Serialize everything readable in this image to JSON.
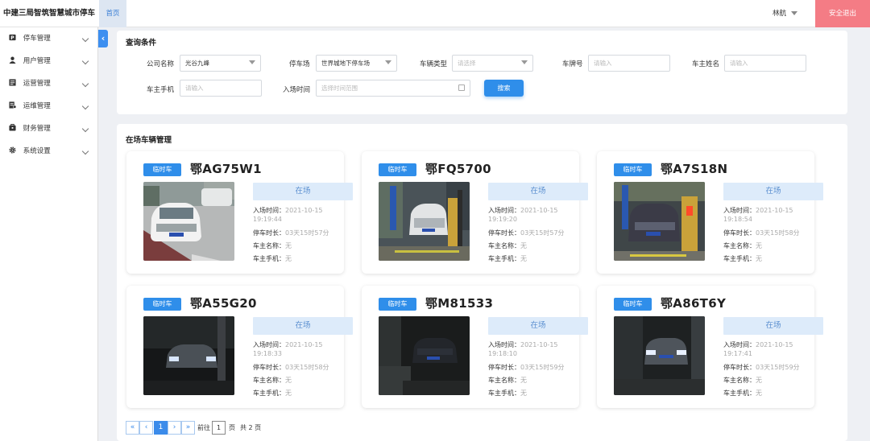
{
  "header": {
    "brand": "中建三局智筑智慧城市停车",
    "home_tab": "首页",
    "user": "林航",
    "logout": "安全退出"
  },
  "sidebar": {
    "items": [
      {
        "label": "停车管理",
        "icon": "parking-icon"
      },
      {
        "label": "用户管理",
        "icon": "user-icon"
      },
      {
        "label": "运营管理",
        "icon": "operations-icon"
      },
      {
        "label": "运维管理",
        "icon": "maintenance-icon"
      },
      {
        "label": "财务管理",
        "icon": "finance-icon"
      },
      {
        "label": "系统设置",
        "icon": "gear-icon"
      }
    ]
  },
  "query": {
    "title": "查询条件",
    "company_label": "公司名称",
    "company_value": "光谷九峰",
    "lot_label": "停车场",
    "lot_value": "世界城地下停车场",
    "vehicle_type_label": "车辆类型",
    "vehicle_type_placeholder": "请选择",
    "plate_label": "车牌号",
    "plate_placeholder": "请输入",
    "owner_name_label": "车主姓名",
    "owner_name_placeholder": "请输入",
    "owner_phone_label": "车主手机",
    "owner_phone_placeholder": "请输入",
    "entry_time_label": "入场时间",
    "entry_time_placeholder": "选择时间范围",
    "search_button": "搜索"
  },
  "vehicles": {
    "title": "在场车辆管理",
    "labels": {
      "entry": "入场时间：",
      "duration": "停车时长：",
      "owner": "车主名称：",
      "phone": "车主手机："
    },
    "cards": [
      {
        "badge": "临时车",
        "plate": "鄂AG75W1",
        "status": "在场",
        "entry_date": "2021-10-15",
        "entry_time": "19:19:44",
        "duration": "03天15时57分",
        "owner": "无",
        "phone": "无"
      },
      {
        "badge": "临时车",
        "plate": "鄂FQ5700",
        "status": "在场",
        "entry_date": "2021-10-15",
        "entry_time": "19:19:20",
        "duration": "03天15时57分",
        "owner": "无",
        "phone": "无"
      },
      {
        "badge": "临时车",
        "plate": "鄂A7S18N",
        "status": "在场",
        "entry_date": "2021-10-15",
        "entry_time": "19:18:54",
        "duration": "03天15时58分",
        "owner": "无",
        "phone": "无"
      },
      {
        "badge": "临时车",
        "plate": "鄂A55G20",
        "status": "在场",
        "entry_date": "2021-10-15",
        "entry_time": "19:18:33",
        "duration": "03天15时58分",
        "owner": "无",
        "phone": "无"
      },
      {
        "badge": "临时车",
        "plate": "鄂M81533",
        "status": "在场",
        "entry_date": "2021-10-15",
        "entry_time": "19:18:10",
        "duration": "03天15时59分",
        "owner": "无",
        "phone": "无"
      },
      {
        "badge": "临时车",
        "plate": "鄂A86T6Y",
        "status": "在场",
        "entry_date": "2021-10-15",
        "entry_time": "19:17:41",
        "duration": "03天15时59分",
        "owner": "无",
        "phone": "无"
      }
    ]
  },
  "pagination": {
    "first": "«",
    "prev": "‹",
    "current": "1",
    "next": "›",
    "last": "»",
    "goto_prefix": "前往",
    "goto_value": "1",
    "goto_suffix": "页",
    "total": "共 2 页"
  }
}
